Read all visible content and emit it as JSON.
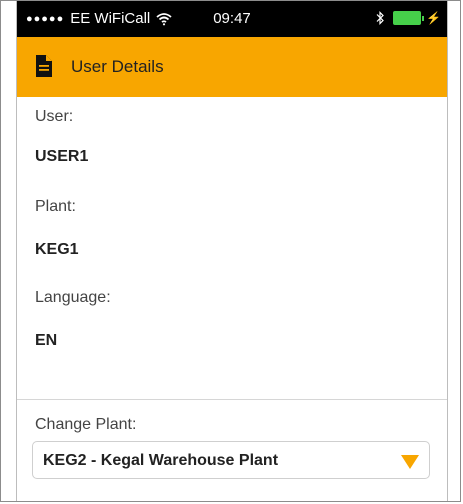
{
  "status": {
    "signal_dots": "●●●●●",
    "carrier": "EE WiFiCall",
    "time": "09:47",
    "charging_symbol": "⚡"
  },
  "appbar": {
    "icon": "document-icon",
    "title": "User Details",
    "color": "#f8a600"
  },
  "details": {
    "user_label": "User:",
    "user_value": "USER1",
    "plant_label": "Plant:",
    "plant_value": "KEG1",
    "language_label": "Language:",
    "language_value": "EN"
  },
  "change_plant": {
    "label": "Change Plant:",
    "selected": "KEG2 - Kegal Warehouse Plant",
    "arrow_color": "#f8a600"
  }
}
